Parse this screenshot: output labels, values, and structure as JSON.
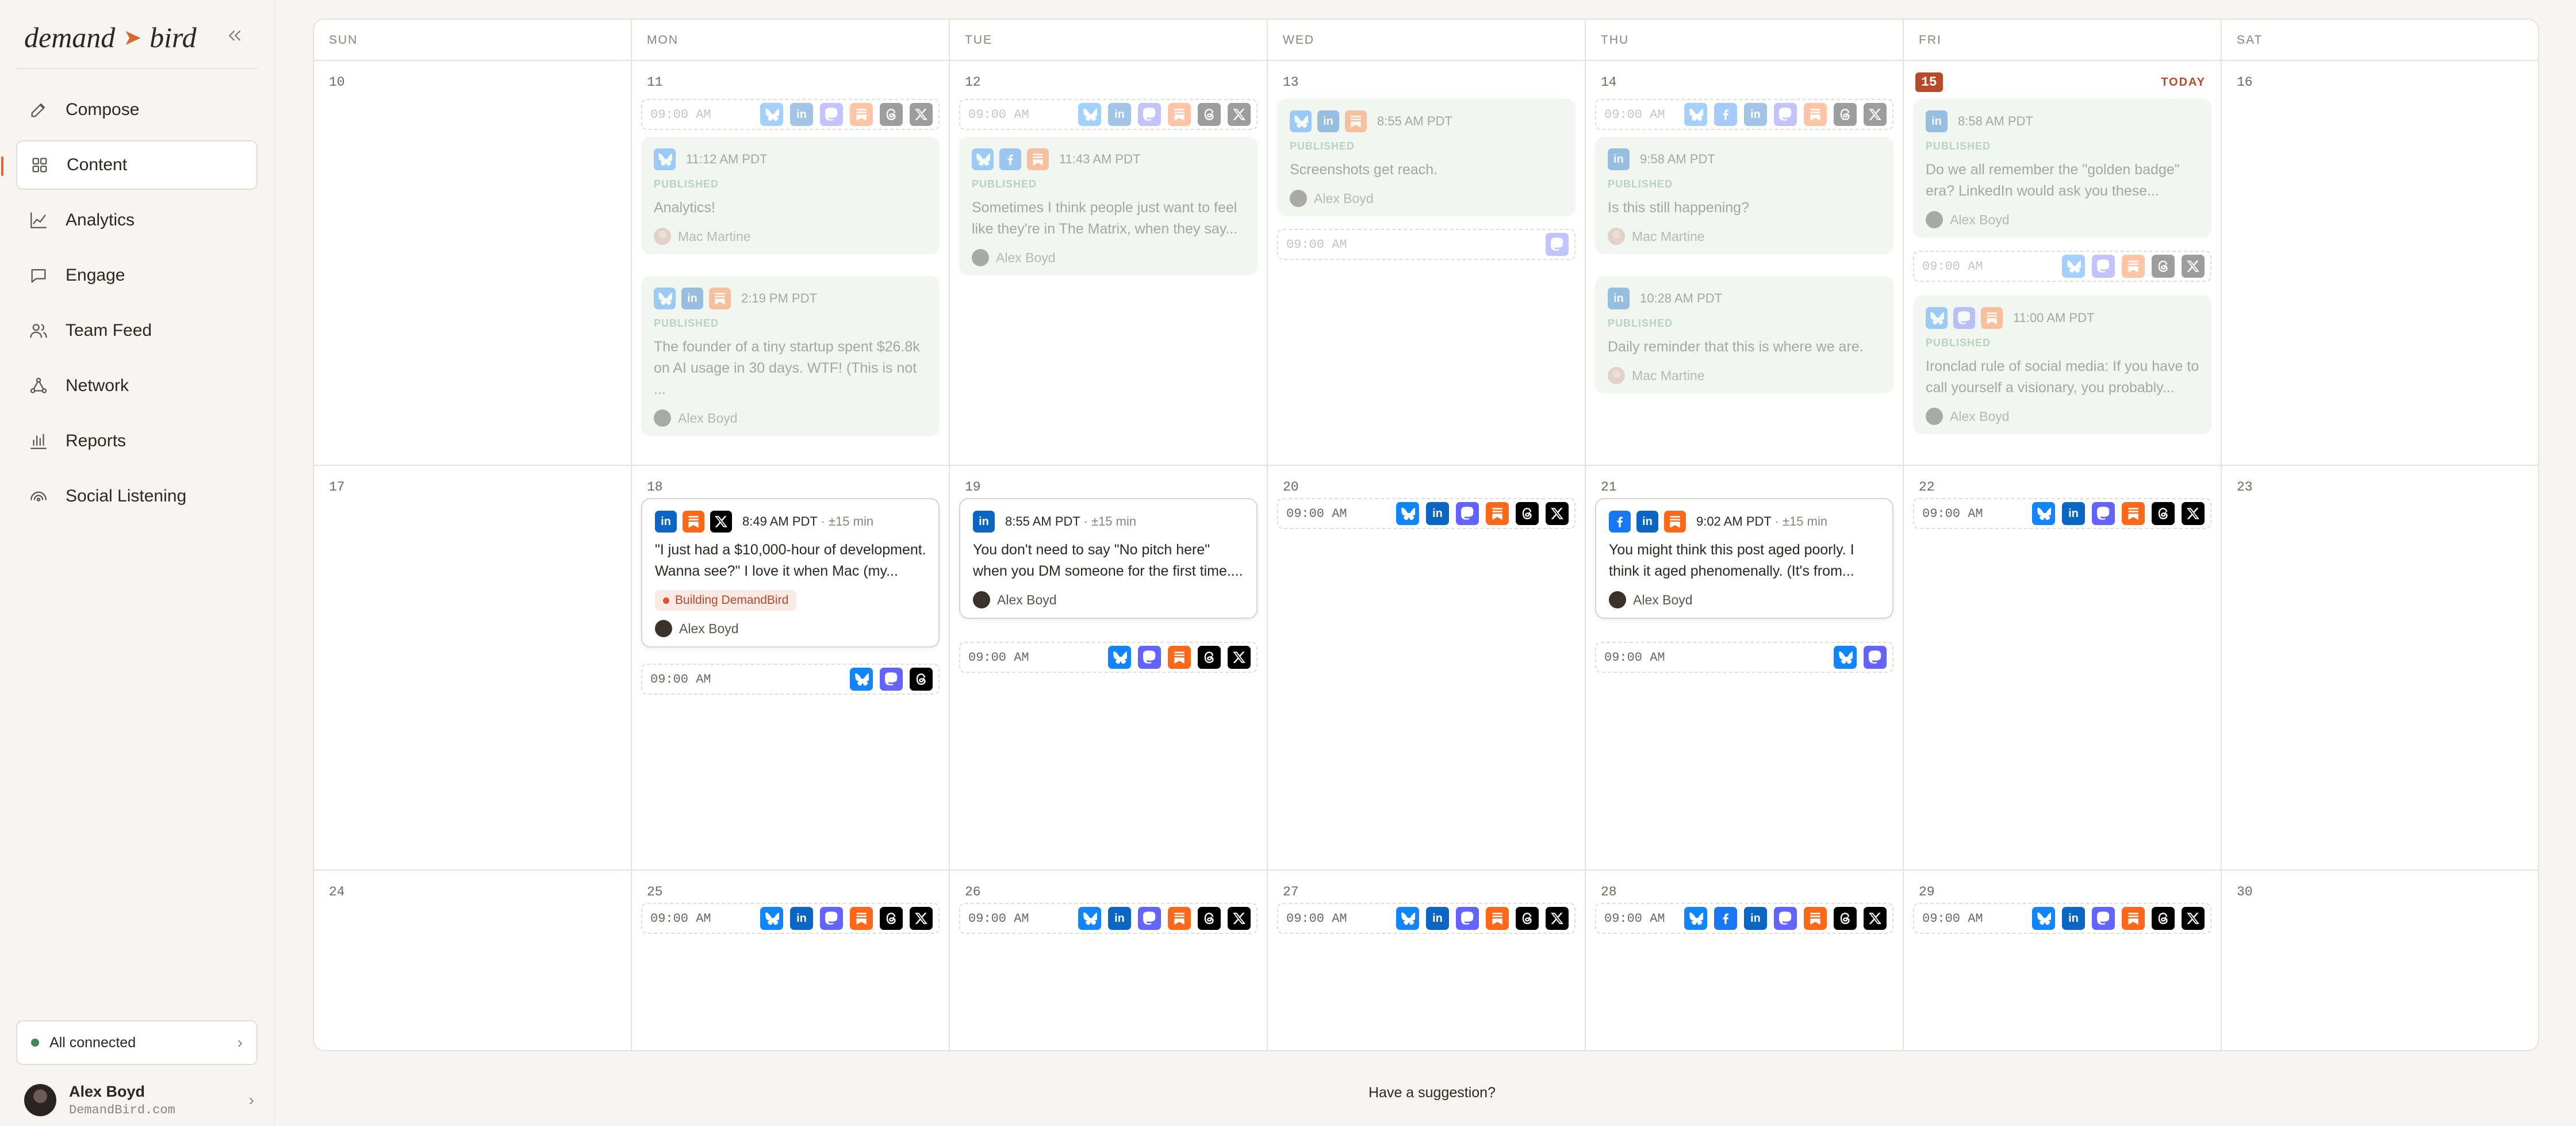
{
  "brand": {
    "word1": "demand",
    "word2": "bird",
    "accent": "#d9692f"
  },
  "nav": [
    {
      "label": "Compose",
      "icon": "pencil-icon"
    },
    {
      "label": "Content",
      "icon": "grid-icon",
      "active": true
    },
    {
      "label": "Analytics",
      "icon": "line-chart-icon"
    },
    {
      "label": "Engage",
      "icon": "chat-bubble-icon"
    },
    {
      "label": "Team Feed",
      "icon": "team-icon"
    },
    {
      "label": "Network",
      "icon": "network-icon"
    },
    {
      "label": "Reports",
      "icon": "bar-chart-icon"
    },
    {
      "label": "Social Listening",
      "icon": "radar-icon"
    }
  ],
  "status": {
    "label": "All connected"
  },
  "user": {
    "name": "Alex Boyd",
    "domain": "DemandBird.com"
  },
  "weekdays": [
    "SUN",
    "MON",
    "TUE",
    "WED",
    "THU",
    "FRI",
    "SAT"
  ],
  "today_label": "TODAY",
  "published_label": "PUBLISHED",
  "suggestion": "Have a suggestion?",
  "weeks": [
    [
      {
        "day": "10",
        "items": []
      },
      {
        "day": "11",
        "items": [
          {
            "type": "slot",
            "time": "09:00 AM",
            "icons": [
              "bluesky",
              "linkedin",
              "mastodon",
              "substack",
              "threads",
              "x"
            ],
            "faded": true
          },
          {
            "type": "post",
            "status": "published",
            "icons": [
              "bluesky"
            ],
            "time": "11:12 AM PDT",
            "text": "Analytics!",
            "author": "Mac Martine"
          },
          {
            "type": "post",
            "status": "published",
            "icons": [
              "bluesky",
              "linkedin",
              "substack"
            ],
            "time": "2:19 PM PDT",
            "text": "The founder of a tiny startup spent $26.8k on AI usage in 30 days. WTF! (This is not ...",
            "author": "Alex Boyd"
          }
        ]
      },
      {
        "day": "12",
        "items": [
          {
            "type": "slot",
            "time": "09:00 AM",
            "icons": [
              "bluesky",
              "linkedin",
              "mastodon",
              "substack",
              "threads",
              "x"
            ],
            "faded": true
          },
          {
            "type": "post",
            "status": "published",
            "icons": [
              "bluesky",
              "facebook",
              "substack"
            ],
            "time": "11:43 AM PDT",
            "text": "Sometimes I think people just want to feel like they're in The Matrix, when they say...",
            "author": "Alex Boyd"
          }
        ]
      },
      {
        "day": "13",
        "items": [
          {
            "type": "post",
            "status": "published",
            "icons": [
              "bluesky",
              "linkedin",
              "substack"
            ],
            "time": "8:55 AM PDT",
            "text": "Screenshots get reach.",
            "author": "Alex Boyd"
          },
          {
            "type": "slot",
            "time": "09:00 AM",
            "icons": [
              "mastodon"
            ],
            "faded": true
          }
        ]
      },
      {
        "day": "14",
        "items": [
          {
            "type": "slot",
            "time": "09:00 AM",
            "icons": [
              "bluesky",
              "facebook",
              "linkedin",
              "mastodon",
              "substack",
              "threads",
              "x"
            ],
            "faded": true
          },
          {
            "type": "post",
            "status": "published",
            "icons": [
              "linkedin"
            ],
            "time": "9:58 AM PDT",
            "text": "Is this still happening?",
            "author": "Mac Martine"
          },
          {
            "type": "post",
            "status": "published",
            "icons": [
              "linkedin"
            ],
            "time": "10:28 AM PDT",
            "text": "Daily reminder that this is where we are.",
            "author": "Mac Martine"
          }
        ]
      },
      {
        "day": "15",
        "today": true,
        "items": [
          {
            "type": "post",
            "status": "published",
            "icons": [
              "linkedin"
            ],
            "time": "8:58 AM PDT",
            "text": "Do we all remember the \"golden badge\" era? LinkedIn would ask you these...",
            "author": "Alex Boyd"
          },
          {
            "type": "slot",
            "time": "09:00 AM",
            "icons": [
              "bluesky",
              "mastodon",
              "substack",
              "threads",
              "x"
            ],
            "faded": true
          },
          {
            "type": "post",
            "status": "published",
            "icons": [
              "bluesky",
              "mastodon",
              "substack"
            ],
            "time": "11:00 AM PDT",
            "text": "Ironclad rule of social media: If you have to call yourself a visionary, you probably...",
            "author": "Alex Boyd"
          }
        ]
      },
      {
        "day": "16",
        "items": []
      }
    ],
    [
      {
        "day": "17",
        "items": []
      },
      {
        "day": "18",
        "items": [
          {
            "type": "post",
            "status": "scheduled",
            "icons": [
              "linkedin",
              "substack",
              "x"
            ],
            "time": "8:49 AM PDT",
            "duration": "· ±15 min",
            "text": "\"I just had a $10,000-hour of development. Wanna see?\" I love it when Mac (my...",
            "tag": "Building DemandBird",
            "author": "Alex Boyd"
          },
          {
            "type": "slot",
            "time": "09:00 AM",
            "icons": [
              "bluesky",
              "mastodon",
              "threads"
            ]
          }
        ]
      },
      {
        "day": "19",
        "items": [
          {
            "type": "post",
            "status": "scheduled",
            "icons": [
              "linkedin"
            ],
            "time": "8:55 AM PDT",
            "duration": "· ±15 min",
            "text": "You don't need to say \"No pitch here\" when you DM someone for the first time....",
            "author": "Alex Boyd"
          },
          {
            "type": "slot",
            "time": "09:00 AM",
            "icons": [
              "bluesky",
              "mastodon",
              "substack",
              "threads",
              "x"
            ]
          }
        ]
      },
      {
        "day": "20",
        "items": [
          {
            "type": "slot",
            "time": "09:00 AM",
            "icons": [
              "bluesky",
              "linkedin",
              "mastodon",
              "substack",
              "threads",
              "x"
            ]
          }
        ]
      },
      {
        "day": "21",
        "items": [
          {
            "type": "post",
            "status": "scheduled",
            "icons": [
              "facebook",
              "linkedin",
              "substack"
            ],
            "time": "9:02 AM PDT",
            "duration": "· ±15 min",
            "text": "You might think this post aged poorly. I think it aged phenomenally. (It's from...",
            "author": "Alex Boyd"
          },
          {
            "type": "slot",
            "time": "09:00 AM",
            "icons": [
              "bluesky",
              "mastodon"
            ]
          }
        ]
      },
      {
        "day": "22",
        "items": [
          {
            "type": "slot",
            "time": "09:00 AM",
            "icons": [
              "bluesky",
              "linkedin",
              "mastodon",
              "substack",
              "threads",
              "x"
            ]
          }
        ]
      },
      {
        "day": "23",
        "items": []
      }
    ],
    [
      {
        "day": "24",
        "items": []
      },
      {
        "day": "25",
        "items": [
          {
            "type": "slot",
            "time": "09:00 AM",
            "icons": [
              "bluesky",
              "linkedin",
              "mastodon",
              "substack",
              "threads",
              "x"
            ]
          }
        ]
      },
      {
        "day": "26",
        "items": [
          {
            "type": "slot",
            "time": "09:00 AM",
            "icons": [
              "bluesky",
              "linkedin",
              "mastodon",
              "substack",
              "threads",
              "x"
            ]
          }
        ]
      },
      {
        "day": "27",
        "items": [
          {
            "type": "slot",
            "time": "09:00 AM",
            "icons": [
              "bluesky",
              "linkedin",
              "mastodon",
              "substack",
              "threads",
              "x"
            ]
          }
        ]
      },
      {
        "day": "28",
        "items": [
          {
            "type": "slot",
            "time": "09:00 AM",
            "icons": [
              "bluesky",
              "facebook",
              "linkedin",
              "mastodon",
              "substack",
              "threads",
              "x"
            ]
          }
        ]
      },
      {
        "day": "29",
        "items": [
          {
            "type": "slot",
            "time": "09:00 AM",
            "icons": [
              "bluesky",
              "linkedin",
              "mastodon",
              "substack",
              "threads",
              "x"
            ]
          }
        ]
      },
      {
        "day": "30",
        "items": []
      }
    ]
  ],
  "platform_colors": {
    "bluesky": "#1185fe",
    "linkedin": "#0a66c2",
    "mastodon": "#6364ff",
    "substack": "#ff6719",
    "threads": "#000000",
    "x": "#000000",
    "facebook": "#1877f2"
  }
}
